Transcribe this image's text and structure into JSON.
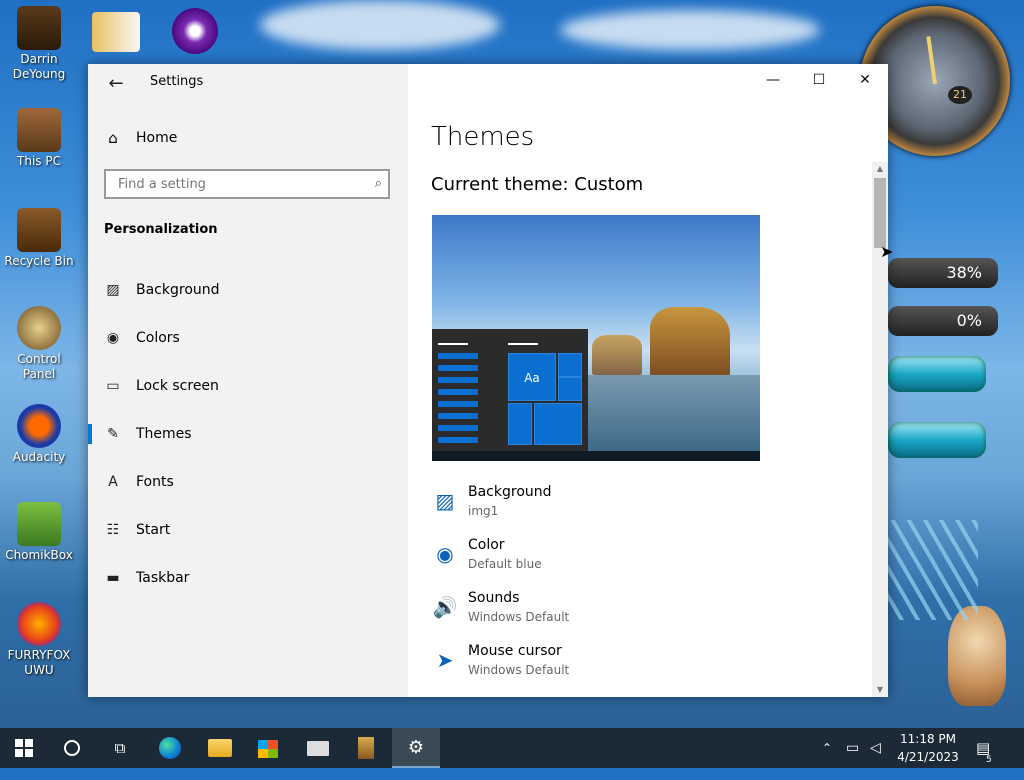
{
  "desktop": {
    "icons": [
      {
        "label": "Darrin DeYoung"
      },
      {
        "label": "This PC"
      },
      {
        "label": "Recycle Bin"
      },
      {
        "label": "Control Panel"
      },
      {
        "label": "Audacity"
      },
      {
        "label": "ChomikBox"
      },
      {
        "label": "FURRYFOX UWU"
      }
    ],
    "gauges": [
      "38%",
      "0%"
    ],
    "clock_date_dial": "21"
  },
  "window": {
    "title": "Settings",
    "back_glyph": "←",
    "controls": {
      "minimize": "—",
      "maximize": "☐",
      "close": "✕"
    }
  },
  "nav": {
    "home": "Home",
    "search_placeholder": "Find a setting",
    "section": "Personalization",
    "items": [
      {
        "label": "Background",
        "icon": "image-icon",
        "glyph": "▨"
      },
      {
        "label": "Colors",
        "icon": "palette-icon",
        "glyph": "◉"
      },
      {
        "label": "Lock screen",
        "icon": "lock-screen-icon",
        "glyph": "▭"
      },
      {
        "label": "Themes",
        "icon": "brush-icon",
        "glyph": "✎"
      },
      {
        "label": "Fonts",
        "icon": "font-icon",
        "glyph": "A"
      },
      {
        "label": "Start",
        "icon": "start-icon",
        "glyph": "☷"
      },
      {
        "label": "Taskbar",
        "icon": "taskbar-icon",
        "glyph": "▬"
      }
    ],
    "selected": "Themes"
  },
  "content": {
    "title": "Themes",
    "current_theme": "Current theme: Custom",
    "preview_tile_label": "Aa",
    "properties": [
      {
        "title": "Background",
        "value": "img1",
        "icon": "image-icon",
        "glyph": "▨"
      },
      {
        "title": "Color",
        "value": "Default blue",
        "icon": "palette-icon",
        "glyph": "◉"
      },
      {
        "title": "Sounds",
        "value": "Windows Default",
        "icon": "speaker-icon",
        "glyph": "🔊"
      },
      {
        "title": "Mouse cursor",
        "value": "Windows Default",
        "icon": "cursor-icon",
        "glyph": "➤"
      }
    ]
  },
  "taskbar": {
    "time": "11:18 PM",
    "date": "4/21/2023",
    "notification_count": "5"
  },
  "colors": {
    "accent": "#0078d7",
    "taskbar": "#1b2a36"
  }
}
